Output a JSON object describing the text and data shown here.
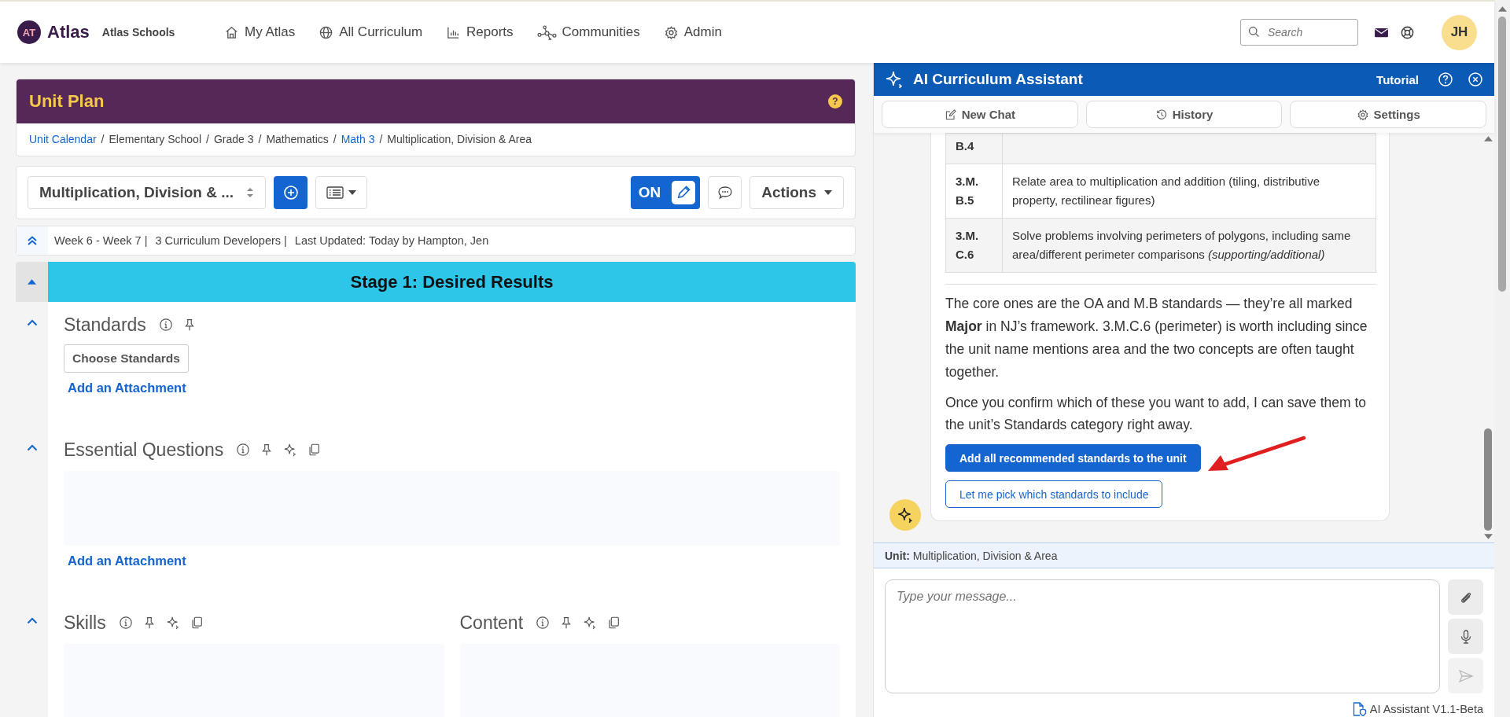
{
  "nav": {
    "logo_mark": "AT",
    "brand": "Atlas",
    "school": "Atlas Schools",
    "items": [
      {
        "label": "My Atlas"
      },
      {
        "label": "All Curriculum"
      },
      {
        "label": "Reports"
      },
      {
        "label": "Communities"
      },
      {
        "label": "Admin"
      }
    ],
    "search": {
      "placeholder": "Search"
    },
    "avatar": "JH"
  },
  "unit_plan": {
    "title": "Unit Plan",
    "help": "?",
    "breadcrumb_separator": "/",
    "breadcrumb": [
      {
        "label": "Unit Calendar",
        "link": true
      },
      {
        "label": "Elementary School",
        "link": false
      },
      {
        "label": "Grade 3",
        "link": false
      },
      {
        "label": "Mathematics",
        "link": false
      },
      {
        "label": "Math 3",
        "link": true
      },
      {
        "label": "Multiplication, Division & Area",
        "link": false
      }
    ],
    "unit_select": "Multiplication, Division & ...",
    "toggle": {
      "label": "ON",
      "on": true
    },
    "actions": "Actions",
    "meta": [
      "Week 6 - Week 7 |",
      "3 Curriculum Developers |",
      "Last Updated: Today by Hampton, Jen"
    ],
    "stage": {
      "title": "Stage 1: Desired Results",
      "expanded": true
    },
    "rows": [
      {
        "expanded": true,
        "fields": [
          {
            "title": "Standards",
            "kind": "standards",
            "ai": false,
            "copy": false,
            "button": "Choose Standards",
            "attachment": "Add an Attachment"
          }
        ]
      },
      {
        "expanded": true,
        "fields": [
          {
            "title": "Essential Questions",
            "kind": "text",
            "ai": true,
            "copy": true,
            "attachment": "Add an Attachment"
          }
        ]
      },
      {
        "expanded": true,
        "fields": [
          {
            "title": "Skills",
            "kind": "text",
            "ai": true,
            "copy": true
          },
          {
            "title": "Content",
            "kind": "text",
            "ai": true,
            "copy": true
          }
        ]
      }
    ]
  },
  "assistant": {
    "title": "AI Curriculum Assistant",
    "tutorial": "Tutorial",
    "tabs": [
      {
        "label": "New Chat"
      },
      {
        "label": "History"
      },
      {
        "label": "Settings"
      }
    ],
    "standards_table": [
      {
        "code": "B.4"
      },
      {
        "code": "3.M. B.5",
        "description": "Relate area to multiplication and addition (tiling, distributive property, rectilinear figures)"
      },
      {
        "code": "3.M. C.6",
        "description": "Solve problems involving perimeters of polygons, including same area/different perimeter comparisons *(supporting/additional)*"
      }
    ],
    "paragraphs": [
      "The core ones are the OA and M.B standards — they’re all marked **Major** in NJ’s framework. 3.M.C.6 (perimeter) is worth including since the unit name mentions area and the two concepts are often taught together.",
      "Once you confirm which of these you want to add, I can save them to the unit’s Standards category right away."
    ],
    "actions": [
      {
        "label": "Add all recommended standards to the unit",
        "kind": "primary"
      },
      {
        "label": "Let me pick which standards to include",
        "kind": "outline"
      }
    ],
    "context": {
      "label": "Unit:",
      "value": "Multiplication, Division & Area"
    },
    "input": {
      "placeholder": "Type your message...",
      "send_disabled": true
    },
    "version": "AI Assistant V1.1-Beta"
  }
}
